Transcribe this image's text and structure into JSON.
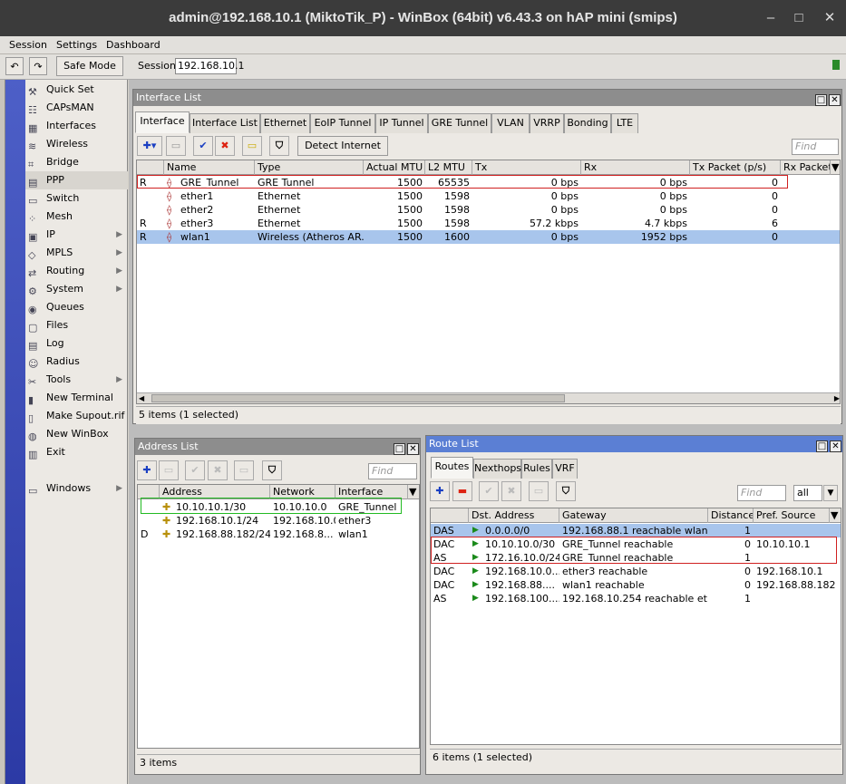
{
  "window_title": "admin@192.168.10.1 (MiktoTik_P) - WinBox (64bit) v6.43.3 on hAP mini (smips)",
  "menu": [
    "Session",
    "Settings",
    "Dashboard"
  ],
  "toolbar": {
    "safe_mode": "Safe Mode",
    "session_label": "Session:",
    "session_value": "192.168.10.1"
  },
  "sidebar": [
    {
      "label": "Quick Set",
      "icon": "quick-set-icon",
      "arrow": false
    },
    {
      "label": "CAPsMAN",
      "icon": "capsman-icon",
      "arrow": false
    },
    {
      "label": "Interfaces",
      "icon": "interfaces-icon",
      "arrow": false
    },
    {
      "label": "Wireless",
      "icon": "wireless-icon",
      "arrow": false
    },
    {
      "label": "Bridge",
      "icon": "bridge-icon",
      "arrow": false
    },
    {
      "label": "PPP",
      "icon": "ppp-icon",
      "arrow": false
    },
    {
      "label": "Switch",
      "icon": "switch-icon",
      "arrow": false
    },
    {
      "label": "Mesh",
      "icon": "mesh-icon",
      "arrow": false
    },
    {
      "label": "IP",
      "icon": "ip-icon",
      "arrow": true
    },
    {
      "label": "MPLS",
      "icon": "mpls-icon",
      "arrow": true
    },
    {
      "label": "Routing",
      "icon": "routing-icon",
      "arrow": true
    },
    {
      "label": "System",
      "icon": "system-icon",
      "arrow": true
    },
    {
      "label": "Queues",
      "icon": "queues-icon",
      "arrow": false
    },
    {
      "label": "Files",
      "icon": "files-icon",
      "arrow": false
    },
    {
      "label": "Log",
      "icon": "log-icon",
      "arrow": false
    },
    {
      "label": "Radius",
      "icon": "radius-icon",
      "arrow": false
    },
    {
      "label": "Tools",
      "icon": "tools-icon",
      "arrow": true
    },
    {
      "label": "New Terminal",
      "icon": "terminal-icon",
      "arrow": false
    },
    {
      "label": "Make Supout.rif",
      "icon": "supout-icon",
      "arrow": false
    },
    {
      "label": "New WinBox",
      "icon": "winbox-icon",
      "arrow": false
    },
    {
      "label": "Exit",
      "icon": "exit-icon",
      "arrow": false
    },
    {
      "label": "Windows",
      "icon": "windows-icon",
      "arrow": true
    }
  ],
  "interface_list": {
    "title": "Interface List",
    "tabs": [
      "Interface",
      "Interface List",
      "Ethernet",
      "EoIP Tunnel",
      "IP Tunnel",
      "GRE Tunnel",
      "VLAN",
      "VRRP",
      "Bonding",
      "LTE"
    ],
    "detect_button": "Detect Internet",
    "find_placeholder": "Find",
    "columns": [
      "Name",
      "Type",
      "Actual MTU",
      "L2 MTU",
      "Tx",
      "Rx",
      "Tx Packet (p/s)",
      "Rx Packet"
    ],
    "rows": [
      {
        "flag": "R",
        "name": "GRE_Tunnel",
        "type": "GRE Tunnel",
        "mtu": "1500",
        "l2mtu": "65535",
        "tx": "0 bps",
        "rx": "0 bps",
        "txp": "0"
      },
      {
        "flag": "",
        "name": "ether1",
        "type": "Ethernet",
        "mtu": "1500",
        "l2mtu": "1598",
        "tx": "0 bps",
        "rx": "0 bps",
        "txp": "0"
      },
      {
        "flag": "",
        "name": "ether2",
        "type": "Ethernet",
        "mtu": "1500",
        "l2mtu": "1598",
        "tx": "0 bps",
        "rx": "0 bps",
        "txp": "0"
      },
      {
        "flag": "R",
        "name": "ether3",
        "type": "Ethernet",
        "mtu": "1500",
        "l2mtu": "1598",
        "tx": "57.2 kbps",
        "rx": "4.7 kbps",
        "txp": "6"
      },
      {
        "flag": "R",
        "name": "wlan1",
        "type": "Wireless (Atheros AR...",
        "mtu": "1500",
        "l2mtu": "1600",
        "tx": "0 bps",
        "rx": "1952 bps",
        "txp": "0"
      }
    ],
    "status": "5 items (1 selected)"
  },
  "address_list": {
    "title": "Address List",
    "find_placeholder": "Find",
    "columns": [
      "Address",
      "Network",
      "Interface"
    ],
    "rows": [
      {
        "flag": "",
        "address": "10.10.10.1/30",
        "network": "10.10.10.0",
        "interface": "GRE_Tunnel"
      },
      {
        "flag": "",
        "address": "192.168.10.1/24",
        "network": "192.168.10.0",
        "interface": "ether3"
      },
      {
        "flag": "D",
        "address": "192.168.88.182/24",
        "network": "192.168.8...",
        "interface": "wlan1"
      }
    ],
    "status": "3 items"
  },
  "route_list": {
    "title": "Route List",
    "tabs": [
      "Routes",
      "Nexthops",
      "Rules",
      "VRF"
    ],
    "find_placeholder": "Find",
    "filter_value": "all",
    "columns": [
      "Dst. Address",
      "Gateway",
      "Distance",
      "Pref. Source"
    ],
    "rows": [
      {
        "flag": "DAS",
        "dst": "0.0.0.0/0",
        "gateway": "192.168.88.1 reachable wlan1",
        "distance": "1",
        "pref": ""
      },
      {
        "flag": "DAC",
        "dst": "10.10.10.0/30",
        "gateway": "GRE_Tunnel reachable",
        "distance": "0",
        "pref": "10.10.10.1"
      },
      {
        "flag": "AS",
        "dst": "172.16.10.0/24",
        "gateway": "GRE_Tunnel reachable",
        "distance": "1",
        "pref": ""
      },
      {
        "flag": "DAC",
        "dst": "192.168.10.0...",
        "gateway": "ether3 reachable",
        "distance": "0",
        "pref": "192.168.10.1"
      },
      {
        "flag": "DAC",
        "dst": "192.168.88....",
        "gateway": "wlan1 reachable",
        "distance": "0",
        "pref": "192.168.88.182"
      },
      {
        "flag": "AS",
        "dst": "192.168.100....",
        "gateway": "192.168.10.254 reachable et...",
        "distance": "1",
        "pref": ""
      }
    ],
    "status": "6 items (1 selected)"
  }
}
